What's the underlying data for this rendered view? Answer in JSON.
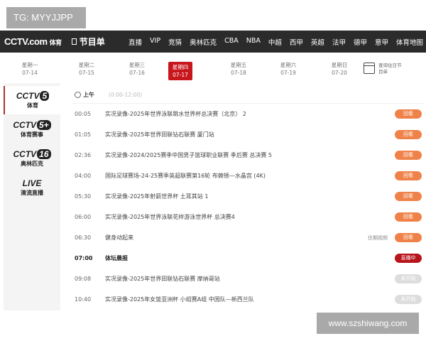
{
  "watermark_top": "TG: MYYJJPP",
  "watermark_bottom": "www.szshiwang.com",
  "nav": {
    "logo": "CCTV.com",
    "logo_sub": "体育",
    "program_label": "节目单",
    "links": [
      "直播",
      "VIP",
      "竞猜",
      "奥林匹克",
      "CBA",
      "NBA",
      "中超",
      "西甲",
      "英超",
      "法甲",
      "德甲",
      "意甲",
      "体育地图"
    ]
  },
  "dates": [
    {
      "day": "星期一",
      "date": "07-14"
    },
    {
      "day": "星期二",
      "date": "07-15"
    },
    {
      "day": "星期三",
      "date": "07-16"
    },
    {
      "day": "星期四",
      "date": "07-17",
      "active": true
    },
    {
      "day": "星期五",
      "date": "07-18"
    },
    {
      "day": "星期六",
      "date": "07-19"
    },
    {
      "day": "星期日",
      "date": "07-20"
    }
  ],
  "calendar": {
    "line1": "查询往日节",
    "line2": "目单"
  },
  "channels": [
    {
      "logo": "CCTV",
      "num": "5",
      "name": "体育",
      "active": true
    },
    {
      "logo": "CCTV",
      "num": "5+",
      "name": "体育赛事"
    },
    {
      "logo": "CCTV",
      "num": "16",
      "name": "奥林匹克"
    },
    {
      "logo": "LIVE",
      "num": "",
      "name": "清流直播"
    }
  ],
  "section": {
    "label": "上午",
    "range": "(0:00-12:00)"
  },
  "schedule": [
    {
      "time": "00:05",
      "title": "实况录像-2025年世界泳联跳水世界杯总决赛（北京） 2",
      "button": "回看",
      "state": "replay"
    },
    {
      "time": "01:05",
      "title": "实况录像-2025年世界田联钻石联赛 厦门站",
      "button": "回看",
      "state": "replay"
    },
    {
      "time": "02:36",
      "title": "实况录像-2024/2025赛季中国男子篮球职业联赛 季后赛 总决赛 5",
      "button": "回看",
      "state": "replay"
    },
    {
      "time": "04:00",
      "title": "国际足球赛场-24-25赛季英超联赛第16轮 布赖顿—水晶宫 (4K)",
      "button": "回看",
      "state": "replay"
    },
    {
      "time": "05:30",
      "title": "实况录像-2025年射箭世界杯 土耳其站 1",
      "button": "回看",
      "state": "replay"
    },
    {
      "time": "06:00",
      "title": "实况录像-2025年世界泳联花样游泳世界杯 总决赛4",
      "button": "回看",
      "state": "replay"
    },
    {
      "time": "06:30",
      "title": "健身动起来",
      "extra": "往期视频",
      "button": "回看",
      "state": "replay"
    },
    {
      "time": "07:00",
      "title": "体坛晨报",
      "button": "直播中",
      "state": "live"
    },
    {
      "time": "09:08",
      "title": "实况录像-2025年世界田联钻石联赛 摩纳哥站",
      "button": "未开始",
      "state": "off"
    },
    {
      "time": "10:40",
      "title": "实况录像-2025年女篮亚洲杯 小组赛A组 中国队—新西兰队",
      "button": "未开始",
      "state": "off"
    }
  ],
  "colors": {
    "nav_bg": "#2b2b2b",
    "accent": "#c8161d",
    "replay": "#ef8248",
    "live": "#b8141b",
    "off": "#dddddd"
  }
}
